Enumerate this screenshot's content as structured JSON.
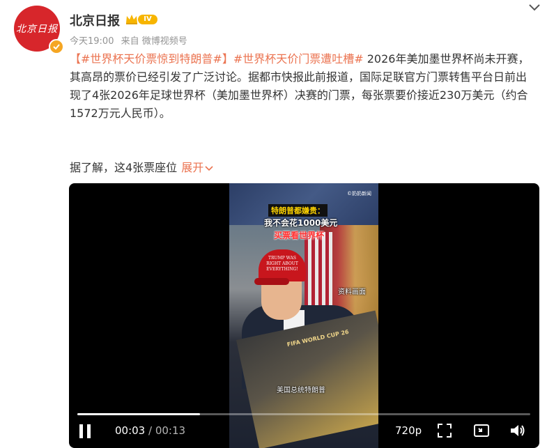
{
  "account": {
    "avatar_text": "北京日报",
    "name": "北京日报",
    "level_badge": "IV",
    "time": "今天19:00",
    "source": "来自 微博视频号"
  },
  "post": {
    "hashtag1": "【#世界杯天价票惊到特朗普#】",
    "hashtag2": "#世界杯天价门票遭吐槽#",
    "body": " 2026年美加墨世界杯尚未开赛，其高昂的票价已经引发了广泛讨论。据都市快报此前报道，国际足联官方门票转售平台日前出现了4张2026年足球世界杯（美加墨世界杯）决赛的门票，每张票要价接近230万美元（约合1572万元人民币）。",
    "more_text": "据了解，这4张票座位",
    "expand_label": "展开"
  },
  "video": {
    "frame_logo": "©奶奶新闻",
    "caption_line1": "特朗普都嫌贵：",
    "caption_line2": "我不会花1000美元",
    "caption_line3": "买票看世界杯",
    "hat_text": "TRUMP WAS RIGHT ABOUT EVERYTHING!",
    "ticket_text": "FIFA WORLD CUP 26",
    "label_archive": "资料画面",
    "label_name": "美国总统特朗普",
    "current_time": "00:03",
    "duration": "00:13",
    "time_separator": " / ",
    "quality": "720p",
    "progress_fraction": 0.27
  },
  "colors": {
    "hashtag": "#eb7350",
    "brand_red": "#d7262b",
    "badge_gold": "#f7b500"
  },
  "icons": {
    "collapse": "chevron-down-icon",
    "pause": "pause-icon",
    "fullscreen": "fullscreen-icon",
    "pip": "picture-in-picture-icon",
    "volume": "volume-icon"
  }
}
